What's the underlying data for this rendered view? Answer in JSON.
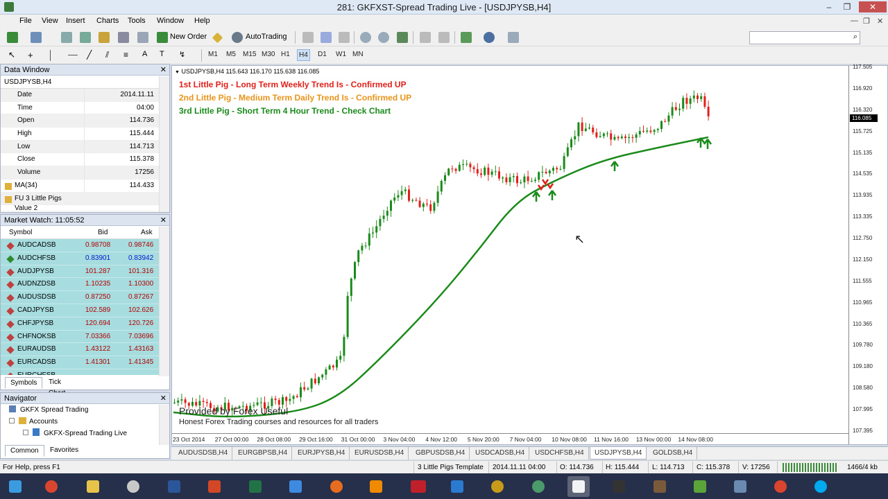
{
  "window": {
    "title": "281: GKFXST-Spread Trading Live - [USDJPYSB,H4]",
    "min": "‒",
    "max": "❐",
    "close": "✕"
  },
  "menu": [
    "File",
    "View",
    "Insert",
    "Charts",
    "Tools",
    "Window",
    "Help"
  ],
  "mdi": {
    "min": "—",
    "restore": "❐",
    "close": "✕"
  },
  "toolbar": {
    "new_order": "New Order",
    "autotrading": "AutoTrading"
  },
  "timeframes": [
    "M1",
    "M5",
    "M15",
    "M30",
    "H1",
    "H4",
    "D1",
    "W1",
    "MN"
  ],
  "active_timeframe": "H4",
  "data_window": {
    "title": "Data Window",
    "symbol": "USDJPYSB,H4",
    "rows": [
      {
        "k": "Date",
        "v": "2014.11.11"
      },
      {
        "k": "Time",
        "v": "04:00"
      },
      {
        "k": "Open",
        "v": "114.736"
      },
      {
        "k": "High",
        "v": "115.444"
      },
      {
        "k": "Low",
        "v": "114.713"
      },
      {
        "k": "Close",
        "v": "115.378"
      },
      {
        "k": "Volume",
        "v": "17256"
      }
    ],
    "ma_label": "MA(34)",
    "ma_value": "114.433",
    "indicator": "FU 3 Little Pigs",
    "partial": "Value 2"
  },
  "market_watch": {
    "title": "Market Watch: 11:05:52",
    "col_symbol": "Symbol",
    "col_bid": "Bid",
    "col_ask": "Ask",
    "rows": [
      {
        "s": "AUDCADSB",
        "b": "0.98708",
        "a": "0.98746",
        "up": false
      },
      {
        "s": "AUDCHFSB",
        "b": "0.83901",
        "a": "0.83942",
        "up": true
      },
      {
        "s": "AUDJPYSB",
        "b": "101.287",
        "a": "101.316",
        "up": false
      },
      {
        "s": "AUDNZDSB",
        "b": "1.10235",
        "a": "1.10300",
        "up": false
      },
      {
        "s": "AUDUSDSB",
        "b": "0.87250",
        "a": "0.87267",
        "up": false
      },
      {
        "s": "CADJPYSB",
        "b": "102.589",
        "a": "102.626",
        "up": false
      },
      {
        "s": "CHFJPYSB",
        "b": "120.694",
        "a": "120.726",
        "up": false
      },
      {
        "s": "CHFNOKSB",
        "b": "7.03366",
        "a": "7.03696",
        "up": false
      },
      {
        "s": "EURAUDSB",
        "b": "1.43122",
        "a": "1.43163",
        "up": false
      },
      {
        "s": "EURCADSB",
        "b": "1.41301",
        "a": "1.41345",
        "up": false
      }
    ],
    "partial": "EURCHFSB",
    "tabs": [
      "Symbols",
      "Tick Chart"
    ]
  },
  "navigator": {
    "title": "Navigator",
    "items": [
      "GKFX Spread Trading",
      "Accounts",
      "GKFX-Spread Trading Live"
    ],
    "tabs": [
      "Common",
      "Favorites"
    ]
  },
  "chart": {
    "header": "USDJPYSB,H4  115.643 116.170 115.638 116.085",
    "line1": "1st Little Pig - Long Term Weekly Trend Is - Confirmed UP",
    "line2": "2nd Little Pig - Medium Term Daily Trend Is - Confirmed UP",
    "line3": "3rd Little Pig - Short Term 4 Hour Trend - Check Chart",
    "color1": "#e0201a",
    "color2": "#e8941a",
    "color3": "#1a8a1a",
    "bull_color": "#1a8a1a",
    "bear_color": "#e0201a",
    "watermark1": "Provided by Forex Useful",
    "watermark2": "Honest Forex Trading courses and resources for all traders",
    "price_ticks": [
      "117.505",
      "116.920",
      "116.320",
      "115.725",
      "115.135",
      "114.535",
      "113.935",
      "113.335",
      "112.750",
      "112.150",
      "111.555",
      "110.965",
      "110.365",
      "109.780",
      "109.180",
      "108.580",
      "107.995",
      "107.395"
    ],
    "current_price": "116.085",
    "date_ticks": [
      "23 Oct 2014",
      "27 Oct 00:00",
      "28 Oct 08:00",
      "29 Oct 16:00",
      "31 Oct 00:00",
      "3 Nov 04:00",
      "4 Nov 12:00",
      "5 Nov 20:00",
      "7 Nov 04:00",
      "10 Nov 08:00",
      "11 Nov 16:00",
      "13 Nov 00:00",
      "14 Nov 08:00"
    ]
  },
  "chart_tabs": [
    "AUDUSDSB,H4",
    "EURGBPSB,H4",
    "EURJPYSB,H4",
    "EURUSDSB,H4",
    "GBPUSDSB,H4",
    "USDCADSB,H4",
    "USDCHFSB,H4",
    "USDJPYSB,H4",
    "GOLDSB,H4"
  ],
  "active_chart_tab": "USDJPYSB,H4",
  "status": {
    "help": "For Help, press F1",
    "template": "3 Little Pigs Template",
    "datetime": "2014.11.11 04:00",
    "o": "O: 114.736",
    "h": "H: 115.444",
    "l": "L: 114.713",
    "c": "C: 115.378",
    "v": "V: 17256",
    "kb": "1466/4 kb"
  },
  "taskbar": [
    "windows-start",
    "chrome",
    "file-explorer",
    "paint",
    "word",
    "powerpoint",
    "excel",
    "dropbox",
    "firefox",
    "vlc",
    "xem",
    "outlook",
    "headphones",
    "network",
    "metatrader",
    "kindle",
    "books",
    "evernote",
    "remote",
    "chrome-alt",
    "skype"
  ]
}
